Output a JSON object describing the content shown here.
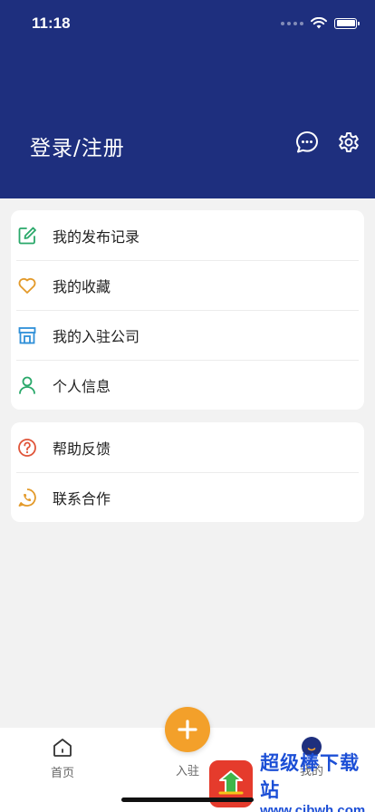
{
  "status_bar": {
    "time": "11:18"
  },
  "header": {
    "login_label": "登录/注册",
    "message_icon": "chat-bubble-icon",
    "settings_icon": "gear-icon"
  },
  "menu_group_1": [
    {
      "label": "我的发布记录",
      "icon": "edit-icon",
      "color": "#2aa86a"
    },
    {
      "label": "我的收藏",
      "icon": "heart-icon",
      "color": "#e39a2a"
    },
    {
      "label": "我的入驻公司",
      "icon": "store-icon",
      "color": "#2e8fd8"
    },
    {
      "label": "个人信息",
      "icon": "person-icon",
      "color": "#2aa86a"
    }
  ],
  "menu_group_2": [
    {
      "label": "帮助反馈",
      "icon": "help-icon",
      "color": "#e0553a"
    },
    {
      "label": "联系合作",
      "icon": "phone-icon",
      "color": "#e39a2a"
    }
  ],
  "tabbar": {
    "home_label": "首页",
    "enter_label": "入驻",
    "me_label": "我的"
  },
  "watermark": {
    "title": "超级棒下载站",
    "url": "www.cjbwh.com"
  },
  "colors": {
    "header_bg": "#1e2f7e",
    "accent": "#f3a02a"
  }
}
